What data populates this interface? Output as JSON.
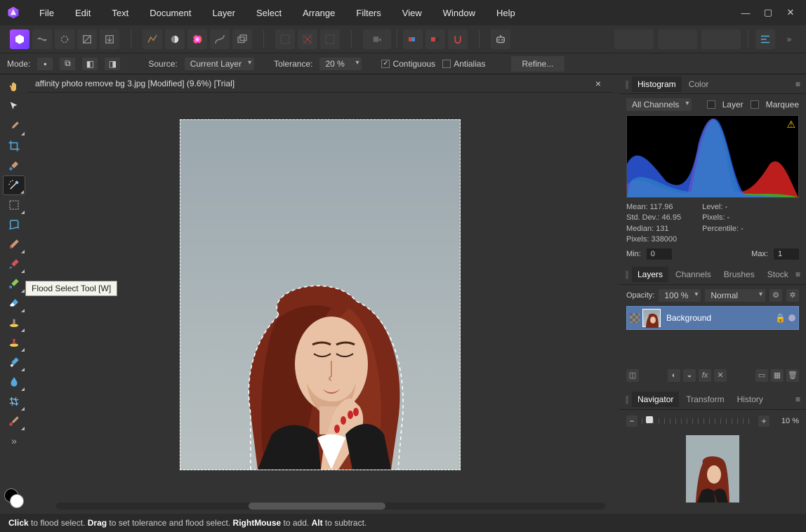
{
  "menu": [
    "File",
    "Edit",
    "Text",
    "Document",
    "Layer",
    "Select",
    "Arrange",
    "Filters",
    "View",
    "Window",
    "Help"
  ],
  "window_controls": {
    "min": "—",
    "max": "▢",
    "close": "✕"
  },
  "toolbar": {
    "persona_icons": [
      "logo-hex",
      "liquify",
      "develop",
      "tonemap",
      "export"
    ],
    "row2": [
      "autolevels",
      "wb",
      "colorwheel",
      "curves",
      "stacks"
    ],
    "row3": [
      "scope1",
      "scope2",
      "scope3"
    ],
    "row4": [
      "grid",
      "swatch",
      "snap"
    ],
    "row5": [
      "assistant"
    ],
    "right": [
      "q1",
      "q2",
      "q3",
      "align",
      "more"
    ]
  },
  "context": {
    "mode_label": "Mode:",
    "mode_icons": [
      "new",
      "add",
      "subtract",
      "intersect"
    ],
    "source_label": "Source:",
    "source_value": "Current Layer",
    "tolerance_label": "Tolerance:",
    "tolerance_value": "20 %",
    "contiguous": {
      "label": "Contiguous",
      "checked": true
    },
    "antialias": {
      "label": "Antialias",
      "checked": false
    },
    "refine": "Refine..."
  },
  "document_tab": "affinity photo remove bg 3.jpg [Modified] (9.6%) [Trial]",
  "tools": [
    {
      "name": "hand",
      "icon": "hand"
    },
    {
      "name": "move",
      "icon": "arrow"
    },
    {
      "name": "color-picker",
      "icon": "eyedrop-dark"
    },
    {
      "name": "crop",
      "icon": "crop"
    },
    {
      "name": "selection-brush",
      "icon": "selbrush"
    },
    {
      "name": "flood-select",
      "icon": "wand",
      "selected": true
    },
    {
      "name": "marquee",
      "icon": "marquee"
    },
    {
      "name": "freehand",
      "icon": "lasso"
    },
    {
      "name": "pen",
      "icon": "pen"
    },
    {
      "name": "brush",
      "icon": "brush"
    },
    {
      "name": "pixel",
      "icon": "pixel"
    },
    {
      "name": "erase",
      "icon": "erase"
    },
    {
      "name": "clone",
      "icon": "clone"
    },
    {
      "name": "inpaint",
      "icon": "inpaint"
    },
    {
      "name": "dodge",
      "icon": "dodge"
    },
    {
      "name": "blur",
      "icon": "blur"
    },
    {
      "name": "mesh",
      "icon": "mesh"
    },
    {
      "name": "red-eye",
      "icon": "redeye"
    }
  ],
  "tooltip": "Flood Select Tool [W]",
  "panels": {
    "histogram": {
      "tabs": [
        "Histogram",
        "Color"
      ],
      "channel": "All Channels",
      "layer_label": "Layer",
      "marquee_label": "Marquee",
      "stats": {
        "mean": "Mean: 117.96",
        "sd": "Std. Dev.: 46.95",
        "median": "Median: 131",
        "pixels": "Pixels: 338000",
        "level": "Level: -",
        "pixels2": "Pixels: -",
        "pct": "Percentile: -"
      },
      "min_label": "Min:",
      "min_val": "0",
      "max_label": "Max:",
      "max_val": "1"
    },
    "layers": {
      "tabs": [
        "Layers",
        "Channels",
        "Brushes",
        "Stock"
      ],
      "opacity_label": "Opacity:",
      "opacity_val": "100 %",
      "blend": "Normal",
      "layer_name": "Background"
    },
    "navigator": {
      "tabs": [
        "Navigator",
        "Transform",
        "History"
      ],
      "zoom": "10 %"
    }
  },
  "status": {
    "parts": [
      {
        "b": "Click",
        "t": " to flood select. "
      },
      {
        "b": "Drag",
        "t": " to set tolerance and flood select. "
      },
      {
        "b": "RightMouse",
        "t": " to add. "
      },
      {
        "b": "Alt",
        "t": " to subtract."
      }
    ]
  }
}
